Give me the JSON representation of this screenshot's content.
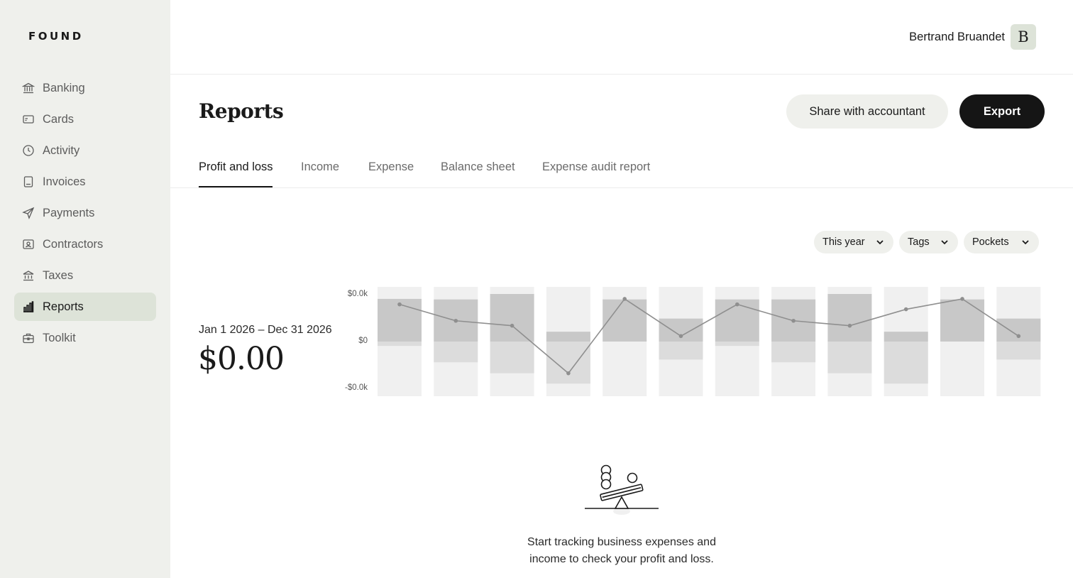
{
  "app": {
    "logo": "FOUND"
  },
  "sidebar": {
    "items": [
      {
        "label": "Banking",
        "icon": "bank-icon"
      },
      {
        "label": "Cards",
        "icon": "card-icon"
      },
      {
        "label": "Activity",
        "icon": "clock-icon"
      },
      {
        "label": "Invoices",
        "icon": "invoice-icon"
      },
      {
        "label": "Payments",
        "icon": "send-icon"
      },
      {
        "label": "Contractors",
        "icon": "contractor-icon"
      },
      {
        "label": "Taxes",
        "icon": "government-building-icon"
      },
      {
        "label": "Reports",
        "icon": "bar-chart-icon",
        "active": true
      },
      {
        "label": "Toolkit",
        "icon": "toolbox-icon"
      }
    ]
  },
  "user": {
    "name": "Bertrand Bruandet",
    "avatar_letter": "B"
  },
  "header": {
    "title": "Reports",
    "share_label": "Share with accountant",
    "export_label": "Export"
  },
  "tabs": [
    {
      "label": "Profit and loss",
      "active": true
    },
    {
      "label": "Income"
    },
    {
      "label": "Expense"
    },
    {
      "label": "Balance sheet"
    },
    {
      "label": "Expense audit report"
    }
  ],
  "filters": {
    "period": "This year",
    "tags": "Tags",
    "pockets": "Pockets"
  },
  "summary": {
    "range": "Jan 1 2026 – Dec 31 2026",
    "total": "$0.00"
  },
  "chart_data": {
    "type": "bar",
    "ytick_labels": [
      "$0.0k",
      "$0",
      "-$0.0k"
    ],
    "ylim": [
      -1,
      1
    ],
    "categories_count": 12,
    "series": [
      {
        "values": [
          0.78,
          0.77,
          0.87,
          0.18,
          0.77,
          0.42,
          0.77,
          0.77,
          0.87,
          0.18,
          0.77,
          0.42
        ]
      },
      {
        "values": [
          -0.08,
          -0.38,
          -0.58,
          -0.77,
          0,
          -0.33,
          -0.08,
          -0.38,
          -0.58,
          -0.77,
          0,
          -0.33
        ]
      },
      {
        "values": [
          0.68,
          0.38,
          0.29,
          -0.58,
          0.78,
          0.1,
          0.68,
          0.38,
          0.29,
          0.59,
          0.78,
          0.1
        ]
      }
    ],
    "colors": {
      "track": "#f0f0f0",
      "income": "#c8c8c8",
      "expense": "#dcdcdc",
      "line": "#8f8f8f"
    },
    "grid": false,
    "legend": "none"
  },
  "empty_state": {
    "icon": "seesaw-balance-icon",
    "text_line1": "Start tracking business expenses and",
    "text_line2": "income to check your profit and loss."
  }
}
